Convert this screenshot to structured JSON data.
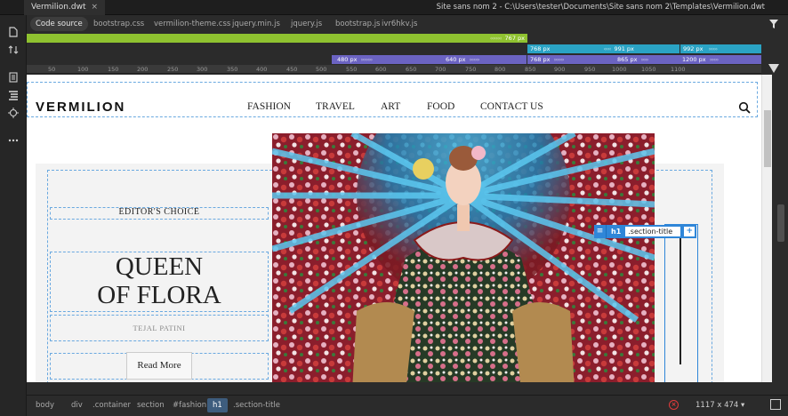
{
  "document_tab": {
    "name": "Vermilion.dwt",
    "close": "×"
  },
  "window_title": "Site sans nom 2 - C:\\Users\\tester\\Documents\\Site sans nom 2\\Templates\\Vermilion.dwt",
  "related_files": [
    "Code source",
    "bootstrap.css",
    "vermilion-theme.css",
    "jquery.min.js",
    "jquery.js",
    "bootstrap.js",
    "ivr6hkv.js"
  ],
  "media_queries": {
    "row1": [
      {
        "label": "767 px",
        "color": "#8fc230"
      },
      {
        "label": "768 px",
        "color": "#2aa3c4"
      },
      {
        "label": "991 px",
        "color": "#2aa3c4"
      },
      {
        "label": "992 px",
        "color": "#2aa3c4"
      }
    ],
    "row2": [
      {
        "label": "480 px",
        "color": "#6b63c2"
      },
      {
        "label": "640 px",
        "color": "#6b63c2"
      },
      {
        "label": "768 px",
        "color": "#6b63c2"
      },
      {
        "label": "865 px",
        "color": "#6b63c2"
      },
      {
        "label": "1200 px",
        "color": "#6b63c2"
      }
    ]
  },
  "ruler_ticks": [
    "50",
    "100",
    "150",
    "200",
    "250",
    "300",
    "350",
    "400",
    "450",
    "500",
    "550",
    "600",
    "650",
    "700",
    "750",
    "800",
    "850",
    "900",
    "950",
    "1000",
    "1050",
    "1100"
  ],
  "site": {
    "logo": "VERMILION",
    "nav": [
      "FASHION",
      "TRAVEL",
      "ART",
      "FOOD",
      "CONTACT US"
    ],
    "section_label": "EDITOR'S CHOICE",
    "title_line1": "QUEEN",
    "title_line2": "OF FLORA",
    "author": "TEJAL PATINI",
    "button": "Read More"
  },
  "hud": {
    "tag": "h1",
    "class_value": ".section-title",
    "plus": "+"
  },
  "breadcrumbs": [
    "body",
    "div",
    ".container",
    "section",
    "#fashion",
    "h1",
    ".section-title"
  ],
  "active_breadcrumb": "h1",
  "viewport_size": "1117 x 474",
  "colors": {
    "accent": "#2f86d8",
    "mq_green": "#8fc230",
    "mq_teal": "#2aa3c4",
    "mq_purple": "#6b63c2",
    "error": "#e23b3b"
  }
}
